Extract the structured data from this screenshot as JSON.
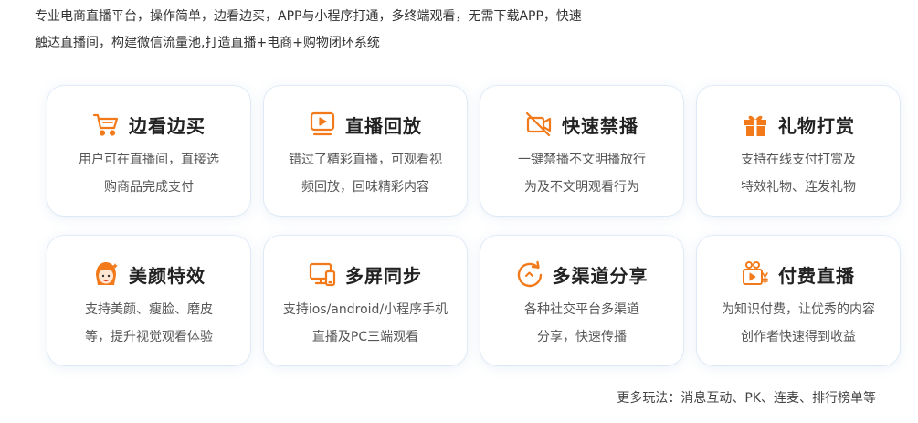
{
  "intro": {
    "line1": "专业电商直播平台，操作简单，边看边买，APP与小程序打通，多终端观看，无需下载APP，快速",
    "line2": "触达直播间，构建微信流量池,打造直播+电商+购物闭环系统"
  },
  "accent_color": "#f27a1a",
  "features": [
    {
      "icon": "shopping-cart-icon",
      "title": "边看边买",
      "desc1": "用户可在直播间，直接选",
      "desc2": "购商品完成支付"
    },
    {
      "icon": "playback-screen-icon",
      "title": "直播回放",
      "desc1": "错过了精彩直播，可观看视",
      "desc2": "频回放，回味精彩内容"
    },
    {
      "icon": "video-off-icon",
      "title": "快速禁播",
      "desc1": "一键禁播不文明播放行",
      "desc2": "为及不文明观看行为"
    },
    {
      "icon": "gift-icon",
      "title": "礼物打赏",
      "desc1": "支持在线支付打赏及",
      "desc2": "特效礼物、连发礼物"
    },
    {
      "icon": "beauty-face-icon",
      "title": "美颜特效",
      "desc1": "支持美颜、瘦脸、磨皮",
      "desc2": "等，提升视觉观看体验"
    },
    {
      "icon": "multi-screen-icon",
      "title": "多屏同步",
      "desc1": "支持ios/android/小程序手机",
      "desc2": "直播及PC三端观看"
    },
    {
      "icon": "share-refresh-icon",
      "title": "多渠道分享",
      "desc1": "各种社交平台多渠道",
      "desc2": "分享，快速传播"
    },
    {
      "icon": "paid-video-icon",
      "title": "付费直播",
      "desc1": "为知识付费，让优秀的内容",
      "desc2": "创作者快速得到收益"
    }
  ],
  "more": "更多玩法：消息互动、PK、连麦、排行榜单等"
}
